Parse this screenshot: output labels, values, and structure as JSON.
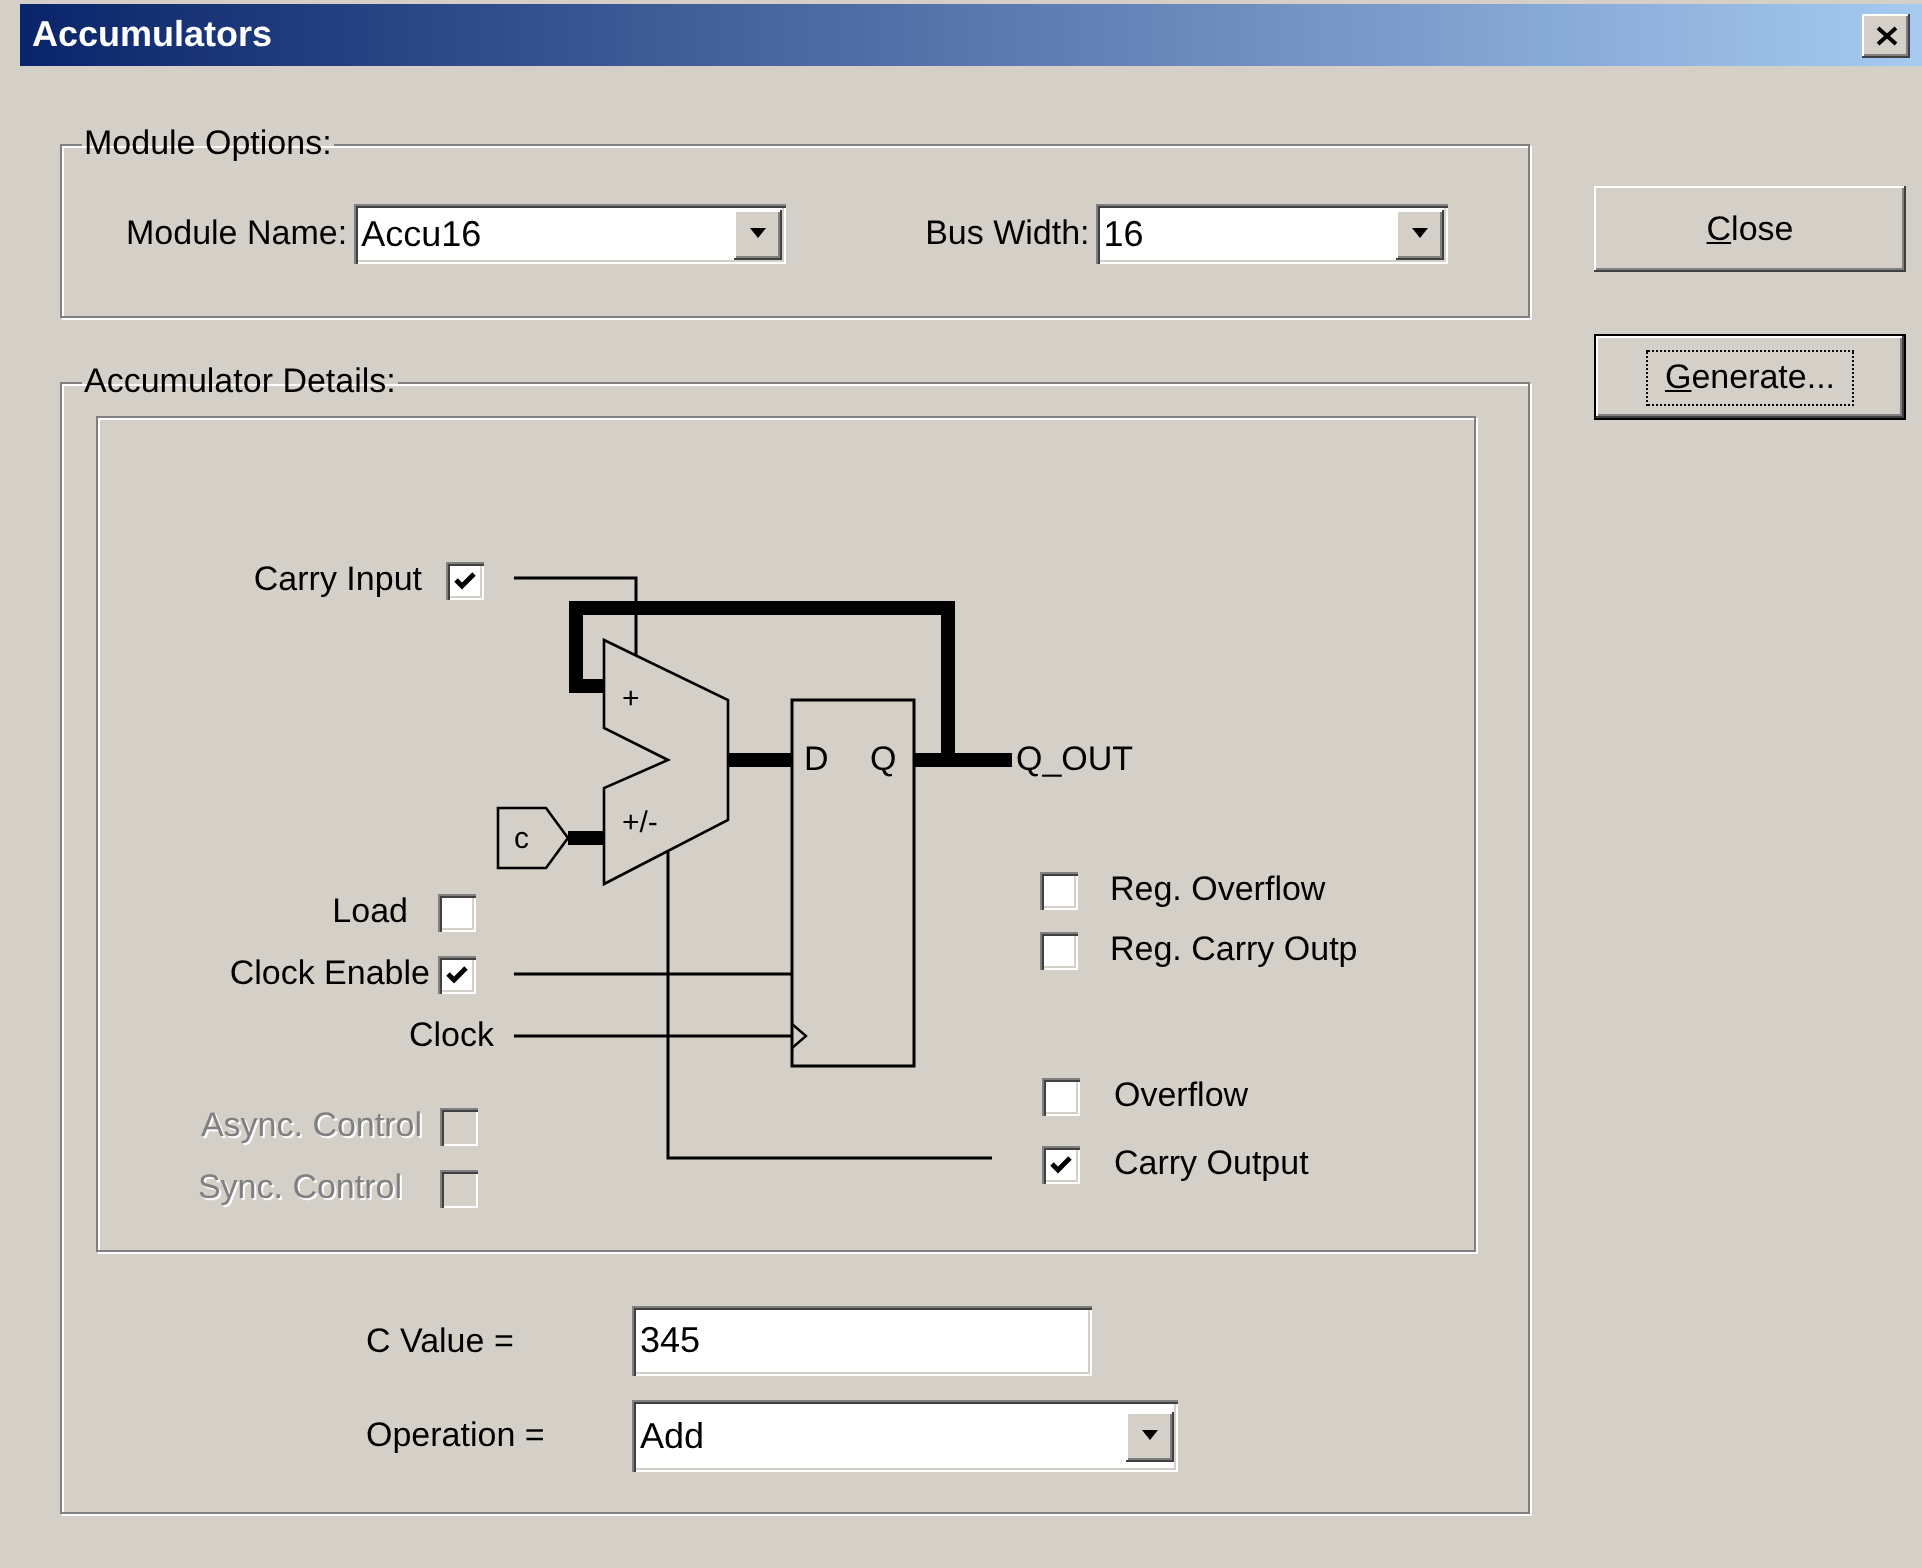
{
  "window": {
    "title": "Accumulators"
  },
  "module_options": {
    "title": "Module Options:",
    "fields": [
      {
        "label": "Module Name:",
        "value": "Accu16"
      },
      {
        "label": "Bus Width:",
        "value": "16"
      }
    ]
  },
  "buttons": [
    {
      "label": "Close",
      "focused": false
    },
    {
      "label": "Generate...",
      "focused": true
    }
  ],
  "details": {
    "title": "Accumulator Details:",
    "schematic": {
      "adder_plus": "+",
      "adder_pm": "+/-",
      "constant": "c",
      "d": "D",
      "q": "Q",
      "output": "Q_OUT"
    },
    "options": [
      {
        "kind": "checkbox",
        "label": "Carry Input",
        "checked": true,
        "disabled": false
      },
      {
        "kind": "checkbox",
        "label": "Load",
        "checked": false,
        "disabled": false
      },
      {
        "kind": "checkbox",
        "label": "Clock Enable",
        "checked": true,
        "disabled": false
      },
      {
        "kind": "label",
        "label": "Clock"
      },
      {
        "kind": "checkbox",
        "label": "Async. Control",
        "checked": false,
        "disabled": true
      },
      {
        "kind": "checkbox",
        "label": "Sync. Control",
        "checked": false,
        "disabled": true
      },
      {
        "kind": "checkbox",
        "label": "Reg. Overflow",
        "checked": false,
        "disabled": false
      },
      {
        "kind": "checkbox",
        "label": "Reg. Carry Outp",
        "checked": false,
        "disabled": false
      },
      {
        "kind": "checkbox",
        "label": "Overflow",
        "checked": false,
        "disabled": false
      },
      {
        "kind": "checkbox",
        "label": "Carry Output",
        "checked": true,
        "disabled": false
      }
    ],
    "c_value": {
      "label": "C Value =",
      "value": "345"
    },
    "operation": {
      "label": "Operation =",
      "value": "Add"
    }
  }
}
